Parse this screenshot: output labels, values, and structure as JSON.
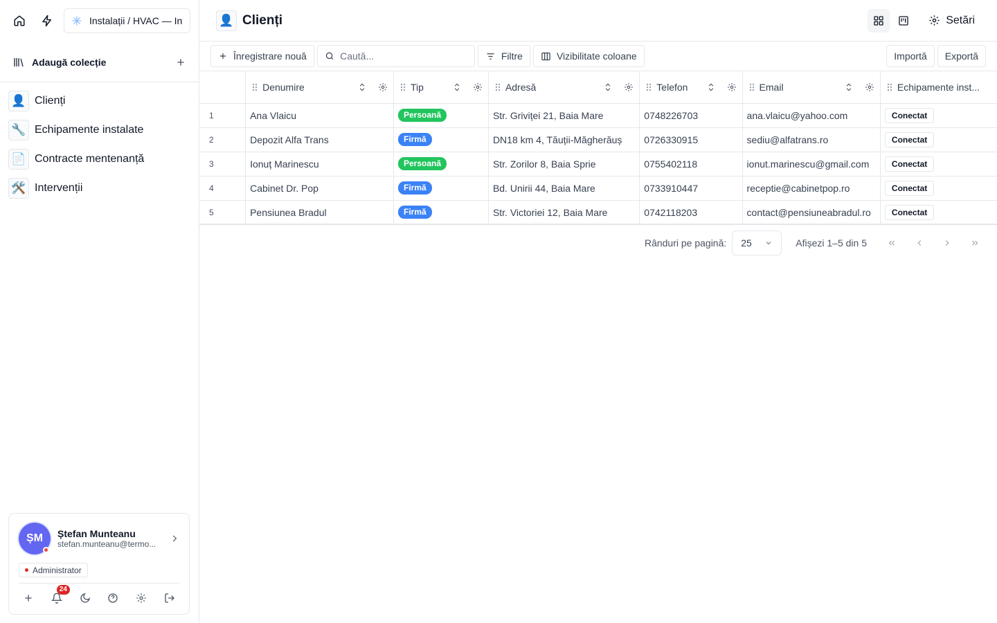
{
  "sidebar": {
    "workspace_name": "Instalații / HVAC — Intervenții",
    "add_collection_label": "Adaugă colecție",
    "items": [
      {
        "label": "Clienți",
        "emoji": "👤"
      },
      {
        "label": "Echipamente instalate",
        "emoji": "🔧"
      },
      {
        "label": "Contracte mentenanță",
        "emoji": "📄"
      },
      {
        "label": "Intervenții",
        "emoji": "🛠️"
      }
    ],
    "user": {
      "initials": "ȘM",
      "name": "Ștefan Munteanu",
      "email": "stefan.munteanu@termo...",
      "role": "Administrator",
      "notifications": "24"
    }
  },
  "header": {
    "icon": "👤",
    "title": "Clienți",
    "settings_label": "Setări"
  },
  "toolbar": {
    "new_record_label": "Înregistrare nouă",
    "search_placeholder": "Caută...",
    "filters_label": "Filtre",
    "columns_label": "Vizibilitate coloane",
    "import_label": "Importă",
    "export_label": "Exportă"
  },
  "table": {
    "columns": [
      "Denumire",
      "Tip",
      "Adresă",
      "Telefon",
      "Email",
      "Echipamente inst..."
    ],
    "rows": [
      {
        "num": "1",
        "name": "Ana Vlaicu",
        "type": "Persoană",
        "address": "Str. Griviței 21, Baia Mare",
        "phone": "0748226703",
        "email": "ana.vlaicu@yahoo.com",
        "equipment": "Conectat"
      },
      {
        "num": "2",
        "name": "Depozit Alfa Trans",
        "type": "Firmă",
        "address": "DN18 km 4, Tăuții-Măgherăuș",
        "phone": "0726330915",
        "email": "sediu@alfatrans.ro",
        "equipment": "Conectat"
      },
      {
        "num": "3",
        "name": "Ionuț Marinescu",
        "type": "Persoană",
        "address": "Str. Zorilor 8, Baia Sprie",
        "phone": "0755402118",
        "email": "ionut.marinescu@gmail.com",
        "equipment": "Conectat"
      },
      {
        "num": "4",
        "name": "Cabinet Dr. Pop",
        "type": "Firmă",
        "address": "Bd. Unirii 44, Baia Mare",
        "phone": "0733910447",
        "email": "receptie@cabinetpop.ro",
        "equipment": "Conectat"
      },
      {
        "num": "5",
        "name": "Pensiunea Bradul",
        "type": "Firmă",
        "address": "Str. Victoriei 12, Baia Mare",
        "phone": "0742118203",
        "email": "contact@pensiuneabradul.ro",
        "equipment": "Conectat"
      }
    ]
  },
  "type_colors": {
    "Persoană": "#22c55e",
    "Firmă": "#3b82f6"
  },
  "pagination": {
    "rows_per_page_label": "Rânduri pe pagină:",
    "rows_per_page_value": "25",
    "range_text": "Afișezi 1–5 din 5"
  }
}
